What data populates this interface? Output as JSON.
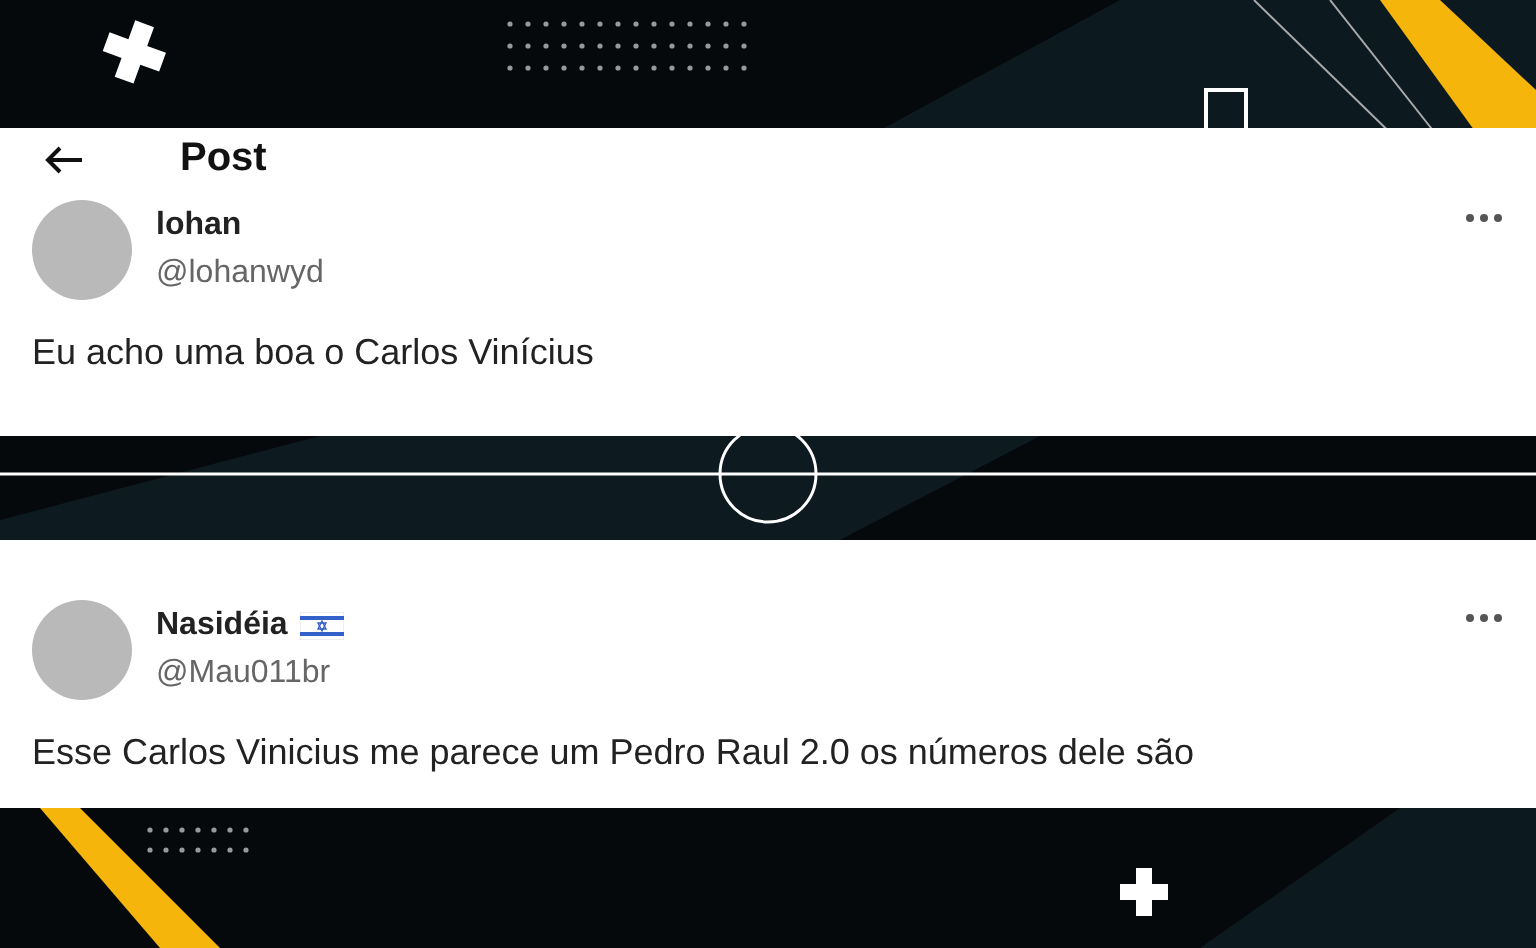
{
  "header": {
    "title": "Post"
  },
  "posts": [
    {
      "display_name": "lohan",
      "flag": false,
      "handle": "@lohanwyd",
      "text": "Eu acho uma boa o Carlos Vinícius"
    },
    {
      "display_name": "Nasidéia",
      "flag": true,
      "handle": "@Mau011br",
      "text": "Esse Carlos Vinicius me parece um Pedro Raul 2.0 os números dele são"
    }
  ]
}
